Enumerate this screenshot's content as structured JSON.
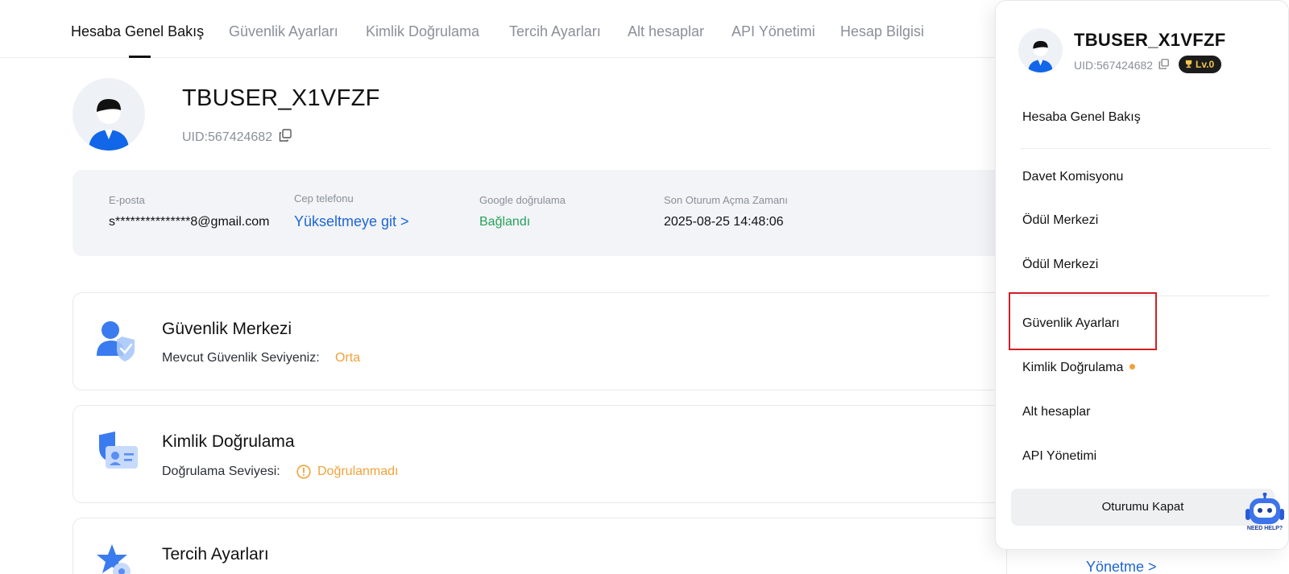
{
  "nav": {
    "tabs": [
      {
        "label": "Hesaba Genel Bakış"
      },
      {
        "label": "Güvenlik Ayarları"
      },
      {
        "label": "Kimlik Doğrulama"
      },
      {
        "label": "Tercih Ayarları"
      },
      {
        "label": "Alt hesaplar"
      },
      {
        "label": "API Yönetimi"
      },
      {
        "label": "Hesap Bilgisi"
      }
    ],
    "active_index": 0
  },
  "profile": {
    "username": "TBUSER_X1VFZF",
    "uid": "UID:567424682"
  },
  "info": {
    "email_label": "E-posta",
    "email_value": "s***************8@gmail.com",
    "phone_label": "Cep telefonu",
    "phone_value": "Yükseltmeye git >",
    "google_label": "Google doğrulama",
    "google_value": "Bağlandı",
    "last_login_label": "Son Oturum Açma Zamanı",
    "last_login_value": "2025-08-25 14:48:06"
  },
  "sections": {
    "security": {
      "title": "Güvenlik Merkezi",
      "sub": "Mevcut Güvenlik Seviyeniz:",
      "level": "Orta"
    },
    "identity": {
      "title": "Kimlik Doğrulama",
      "sub": "Doğrulama Seviyesi:",
      "level": "Doğrulanmadı"
    },
    "preferences": {
      "title": "Tercih Ayarları",
      "link": "Yönetme >"
    }
  },
  "dropdown": {
    "username": "TBUSER_X1VFZF",
    "uid": "UID:567424682",
    "level_badge": "Lv.0",
    "items": [
      {
        "label": "Hesaba Genel Bakış"
      },
      {
        "label": "Davet Komisyonu"
      },
      {
        "label": "Ödül Merkezi"
      },
      {
        "label": "Ödül Merkezi"
      },
      {
        "label": "Güvenlik Ayarları"
      },
      {
        "label": "Kimlik Doğrulama"
      },
      {
        "label": "Alt hesaplar"
      },
      {
        "label": "API Yönetimi"
      }
    ],
    "logout": "Oturumu Kapat"
  },
  "help": {
    "label": "NEED HELP?"
  },
  "colors": {
    "link": "#1e66d6",
    "success": "#25a35a",
    "warning": "#f0a23a",
    "highlight": "#d21f26"
  },
  "icons": [
    "copy-icon",
    "trophy-icon",
    "security-shield-icon",
    "id-card-icon",
    "star-settings-icon",
    "warning-icon",
    "help-robot-icon"
  ]
}
